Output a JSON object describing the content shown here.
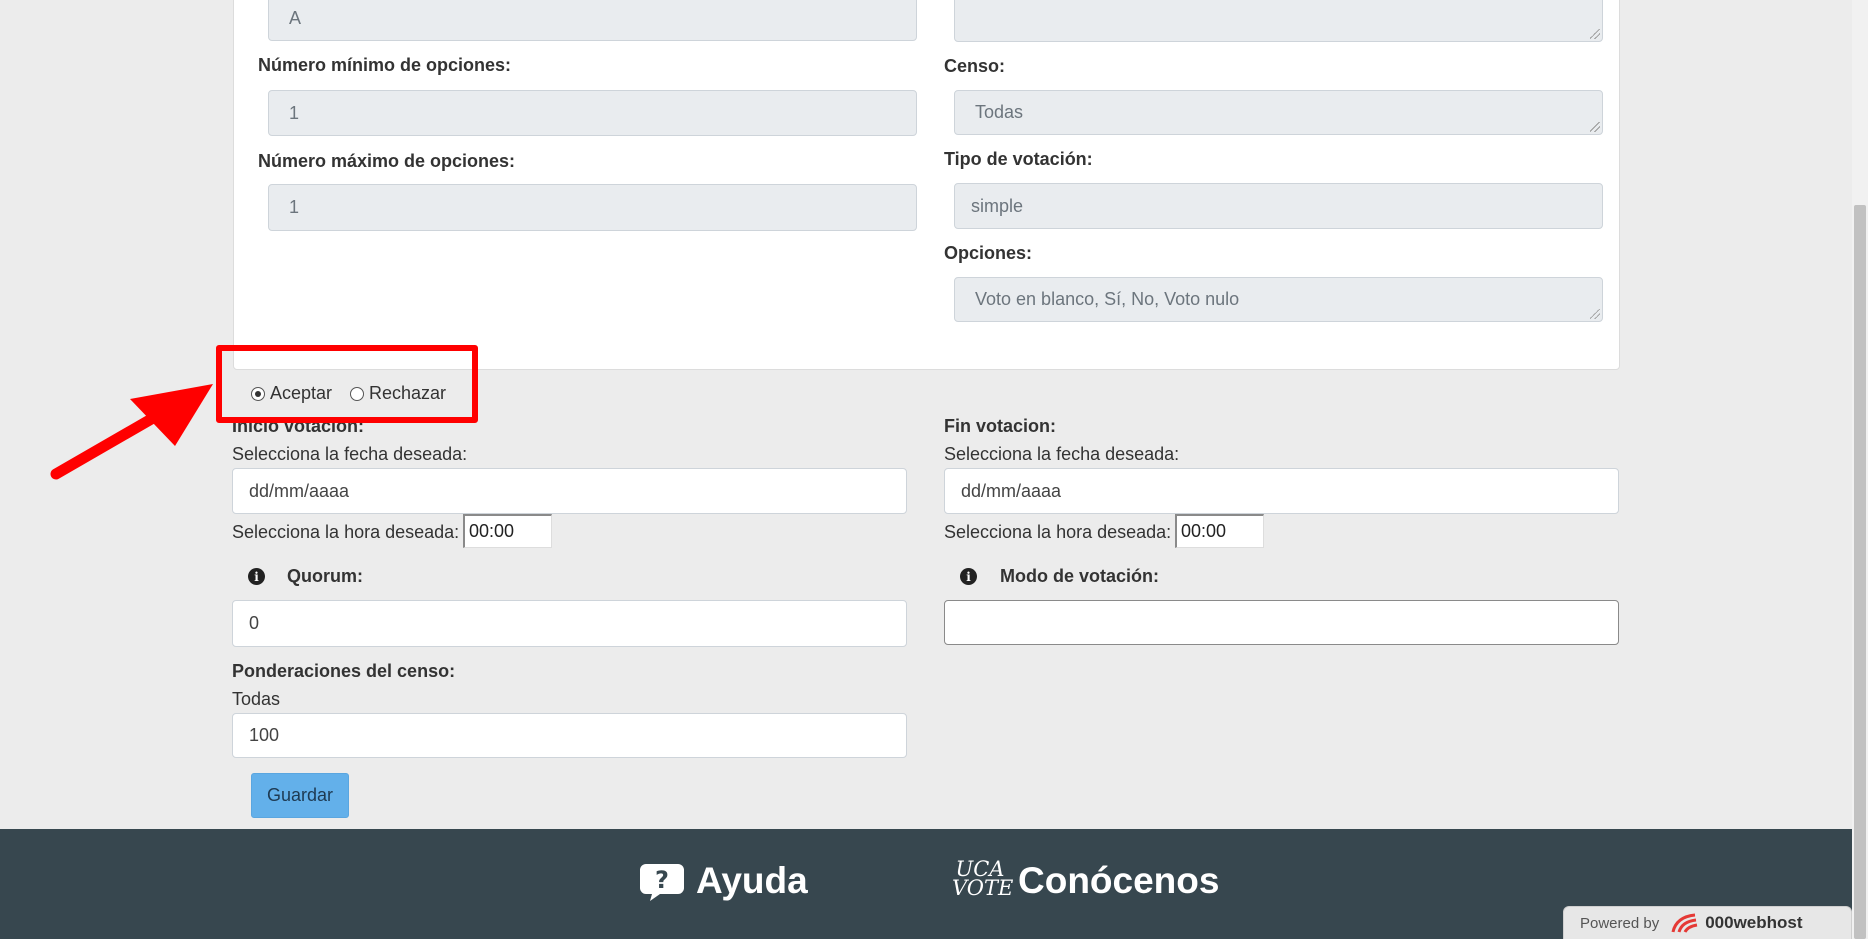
{
  "form": {
    "field_a_value": "A",
    "min_options_label": "Número mínimo de opciones:",
    "min_options_value": "1",
    "max_options_label": "Número máximo de opciones:",
    "max_options_value": "1",
    "censo_label": "Censo:",
    "censo_value": "Todas",
    "tipo_label": "Tipo de votación:",
    "tipo_value": "simple",
    "opciones_label": "Opciones:",
    "opciones_value": "Voto en blanco, Sí, No, Voto nulo",
    "accept_label": "Aceptar",
    "reject_label": "Rechazar",
    "inicio_label": "Inicio votacion:",
    "fin_label": "Fin votacion:",
    "fecha_prompt": "Selecciona la fecha deseada:",
    "fecha_placeholder": "dd/mm/aaaa",
    "hora_prompt": "Selecciona la hora deseada:",
    "hora_value": "00:00",
    "quorum_label": "Quorum:",
    "quorum_value": "0",
    "modo_label": "Modo de votación:",
    "modo_value": "",
    "ponderaciones_label": "Ponderaciones del censo:",
    "ponderaciones_group": "Todas",
    "ponderaciones_value": "100",
    "save_label": "Guardar"
  },
  "footer": {
    "help_label": "Ayuda",
    "about_label": "Conócenos",
    "logo_top": "UCA",
    "logo_bottom": "VOTE",
    "powered_by": "Powered by",
    "host_name": "000webhost"
  },
  "colors": {
    "annotation": "#ff0000",
    "footer_bg": "#37474f",
    "button_bg": "#63b0ea"
  }
}
